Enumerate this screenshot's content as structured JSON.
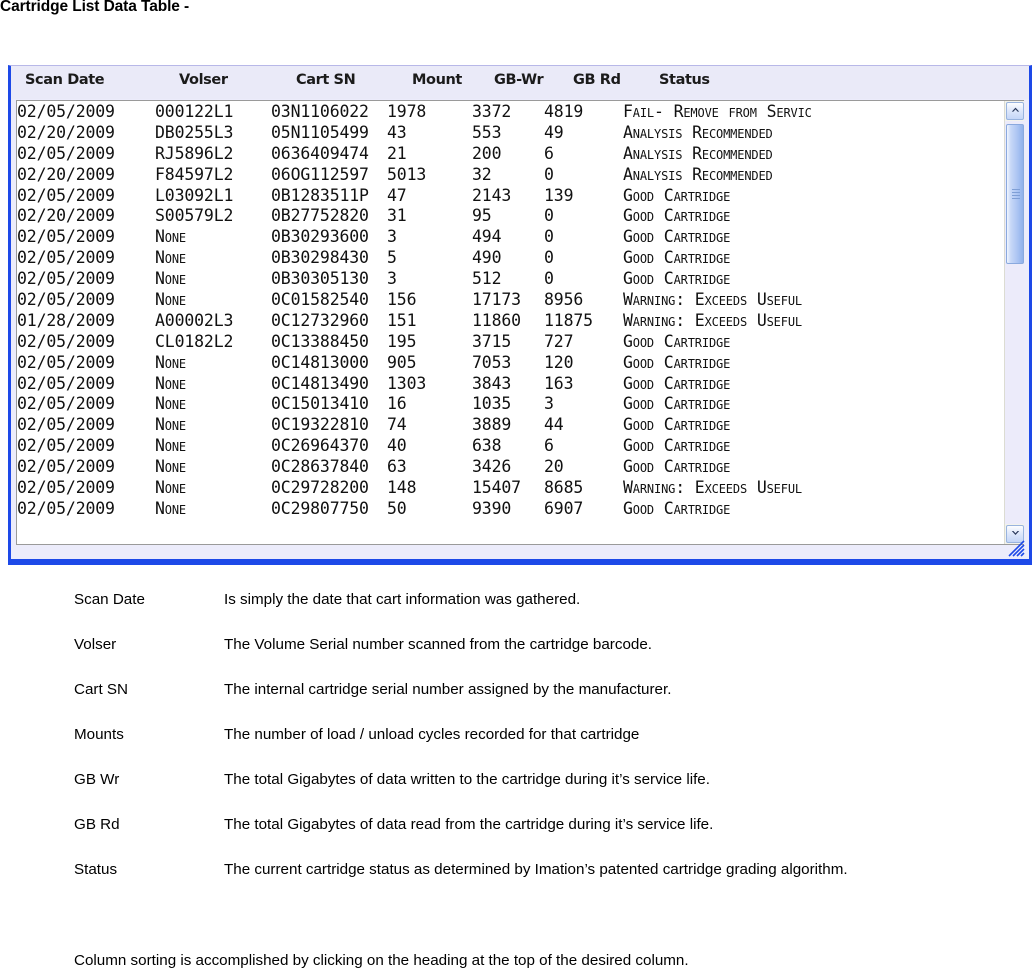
{
  "document": {
    "title": "Cartridge List Data Table -",
    "closing_note": "Column sorting is accomplished by clicking on the heading at the top of the desired column."
  },
  "colors": {
    "panel_border": "#1d49e8",
    "header_bg": "#eaeaf8",
    "grid_bg": "#ffffff",
    "scrollbar_thumb": "#a8c2f2",
    "text": "#000000"
  },
  "table": {
    "columns": [
      {
        "key": "scan_date",
        "label": "Scan Date"
      },
      {
        "key": "volser",
        "label": "Volser"
      },
      {
        "key": "cart_sn",
        "label": "Cart SN"
      },
      {
        "key": "mount",
        "label": "Mount"
      },
      {
        "key": "gb_wr",
        "label": "GB-Wr"
      },
      {
        "key": "gb_rd",
        "label": "GB Rd"
      },
      {
        "key": "status",
        "label": "Status"
      }
    ],
    "rows": [
      {
        "scan_date": "02/05/2009",
        "volser": "000122L1",
        "cart_sn": "03N1106022",
        "mount": "1978",
        "gb_wr": "3372",
        "gb_rd": "4819",
        "status": "Fail- Remove from Servic"
      },
      {
        "scan_date": "02/20/2009",
        "volser": "DB0255L3",
        "cart_sn": "05N1105499",
        "mount": "43",
        "gb_wr": "553",
        "gb_rd": "49",
        "status": "Analysis Recommended"
      },
      {
        "scan_date": "02/05/2009",
        "volser": "RJ5896L2",
        "cart_sn": "0636409474",
        "mount": "21",
        "gb_wr": "200",
        "gb_rd": "6",
        "status": "Analysis Recommended"
      },
      {
        "scan_date": "02/20/2009",
        "volser": "F84597L2",
        "cart_sn": "06OG112597",
        "mount": "5013",
        "gb_wr": "32",
        "gb_rd": "0",
        "status": "Analysis Recommended"
      },
      {
        "scan_date": "02/05/2009",
        "volser": "L03092L1",
        "cart_sn": "0B1283511P",
        "mount": "47",
        "gb_wr": "2143",
        "gb_rd": "139",
        "status": "Good Cartridge"
      },
      {
        "scan_date": "02/20/2009",
        "volser": "S00579L2",
        "cart_sn": "0B27752820",
        "mount": "31",
        "gb_wr": "95",
        "gb_rd": "0",
        "status": "Good Cartridge"
      },
      {
        "scan_date": "02/05/2009",
        "volser": "None",
        "cart_sn": "0B30293600",
        "mount": "3",
        "gb_wr": "494",
        "gb_rd": "0",
        "status": "Good Cartridge"
      },
      {
        "scan_date": "02/05/2009",
        "volser": "None",
        "cart_sn": "0B30298430",
        "mount": "5",
        "gb_wr": "490",
        "gb_rd": "0",
        "status": "Good Cartridge"
      },
      {
        "scan_date": "02/05/2009",
        "volser": "None",
        "cart_sn": "0B30305130",
        "mount": "3",
        "gb_wr": "512",
        "gb_rd": "0",
        "status": "Good Cartridge"
      },
      {
        "scan_date": "02/05/2009",
        "volser": "None",
        "cart_sn": "0C01582540",
        "mount": "156",
        "gb_wr": "17173",
        "gb_rd": "8956",
        "status": "Warning: Exceeds Useful"
      },
      {
        "scan_date": "01/28/2009",
        "volser": "A00002L3",
        "cart_sn": "0C12732960",
        "mount": "151",
        "gb_wr": "11860",
        "gb_rd": "11875",
        "status": "Warning: Exceeds Useful"
      },
      {
        "scan_date": "02/05/2009",
        "volser": "CL0182L2",
        "cart_sn": "0C13388450",
        "mount": "195",
        "gb_wr": "3715",
        "gb_rd": "727",
        "status": "Good Cartridge"
      },
      {
        "scan_date": "02/05/2009",
        "volser": "None",
        "cart_sn": "0C14813000",
        "mount": "905",
        "gb_wr": "7053",
        "gb_rd": "120",
        "status": "Good Cartridge"
      },
      {
        "scan_date": "02/05/2009",
        "volser": "None",
        "cart_sn": "0C14813490",
        "mount": "1303",
        "gb_wr": "3843",
        "gb_rd": "163",
        "status": "Good Cartridge"
      },
      {
        "scan_date": "02/05/2009",
        "volser": "None",
        "cart_sn": "0C15013410",
        "mount": "16",
        "gb_wr": "1035",
        "gb_rd": "3",
        "status": "Good Cartridge"
      },
      {
        "scan_date": "02/05/2009",
        "volser": "None",
        "cart_sn": "0C19322810",
        "mount": "74",
        "gb_wr": "3889",
        "gb_rd": "44",
        "status": "Good Cartridge"
      },
      {
        "scan_date": "02/05/2009",
        "volser": "None",
        "cart_sn": "0C26964370",
        "mount": "40",
        "gb_wr": "638",
        "gb_rd": "6",
        "status": "Good Cartridge"
      },
      {
        "scan_date": "02/05/2009",
        "volser": "None",
        "cart_sn": "0C28637840",
        "mount": "63",
        "gb_wr": "3426",
        "gb_rd": "20",
        "status": "Good Cartridge"
      },
      {
        "scan_date": "02/05/2009",
        "volser": "None",
        "cart_sn": "0C29728200",
        "mount": "148",
        "gb_wr": "15407",
        "gb_rd": "8685",
        "status": "Warning: Exceeds Useful"
      },
      {
        "scan_date": "02/05/2009",
        "volser": "None",
        "cart_sn": "0C29807750",
        "mount": "50",
        "gb_wr": "9390",
        "gb_rd": "6907",
        "status": "Good Cartridge"
      }
    ]
  },
  "scrollbar": {
    "up_icon": "chevron-up-icon",
    "down_icon": "chevron-down-icon",
    "thumb_position_percent": 0
  },
  "definitions": [
    {
      "term": "Scan Date",
      "description": "Is simply the date that cart information was gathered."
    },
    {
      "term": "Volser",
      "description": "The Volume Serial number scanned from the cartridge barcode."
    },
    {
      "term": "Cart SN",
      "description": "The internal cartridge serial number assigned by the manufacturer."
    },
    {
      "term": "Mounts",
      "description": "The number of load / unload cycles recorded for that cartridge"
    },
    {
      "term": "GB Wr",
      "description": "The total Gigabytes of data written to the cartridge during it’s service life."
    },
    {
      "term": "GB Rd",
      "description": "The total Gigabytes of data read from the cartridge during it’s service life."
    },
    {
      "term": "Status",
      "description": "The current cartridge status as determined by Imation’s patented cartridge grading algorithm."
    }
  ]
}
